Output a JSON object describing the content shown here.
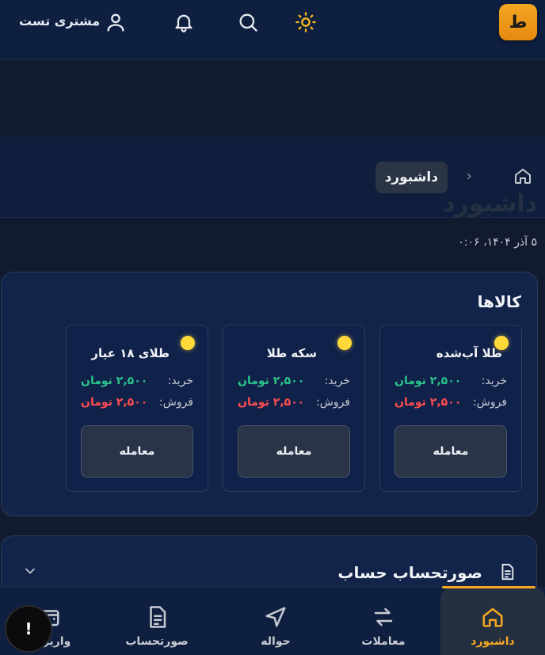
{
  "header": {
    "logo_letter": "ط",
    "user_name": "مشتری تست",
    "icons": [
      "sun-icon",
      "search-icon",
      "bell-icon",
      "user-icon"
    ]
  },
  "breadcrumb": {
    "current": "داشبورد",
    "ghost_title": "داشبورد"
  },
  "date": "۵ آذر ۱۴۰۴، ۰:۰۶",
  "goods": {
    "title": "کالاها",
    "buy_label": "خرید:",
    "sell_label": "فروش:",
    "trade_label": "معامله",
    "items": [
      {
        "name": "طلا آب‌شده",
        "buy": "۲,۵۰۰ تومان",
        "sell": "۲,۵۰۰ تومان"
      },
      {
        "name": "سکه طلا",
        "buy": "۲,۵۰۰ تومان",
        "sell": "۲,۵۰۰ تومان"
      },
      {
        "name": "طلای ۱۸ عیار",
        "buy": "۲,۵۰۰ تومان",
        "sell": "۲,۵۰۰ تومان"
      }
    ]
  },
  "statement": {
    "title": "صورتحساب حساب"
  },
  "nav": {
    "items": [
      {
        "label": "داشبورد",
        "icon": "home-icon",
        "active": true
      },
      {
        "label": "معاملات",
        "icon": "swap-icon",
        "active": false
      },
      {
        "label": "حواله",
        "icon": "send-icon",
        "active": false
      },
      {
        "label": "صورتحساب",
        "icon": "document-icon",
        "active": false
      },
      {
        "label": "واریز/بر",
        "icon": "wallet-icon",
        "active": false
      }
    ]
  },
  "fab_label": "!",
  "colors": {
    "accent": "#f7a823",
    "buy": "#2bc48a",
    "sell": "#ff4d4f",
    "dot": "#ffd83a"
  }
}
